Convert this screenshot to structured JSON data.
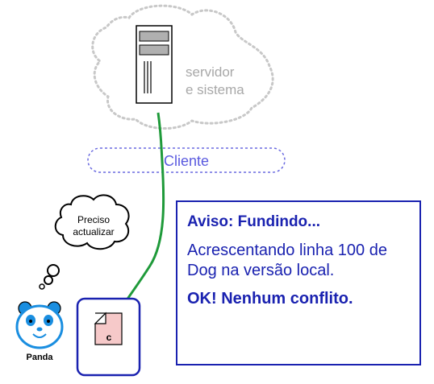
{
  "server": {
    "label_line1": "servidor",
    "label_line2": "e sistema"
  },
  "client": {
    "label": "Cliente"
  },
  "thought": {
    "line1": "Preciso",
    "line2": "actualizar"
  },
  "user": {
    "name": "Panda"
  },
  "file": {
    "letter": "c"
  },
  "notice": {
    "title": "Aviso: Fundindo...",
    "body": "Acrescentando linha 100 de Dog na versão local.",
    "result": "OK! Nenhum conflito."
  },
  "colors": {
    "accent": "#1a22b0",
    "arrow": "#1f9a3a",
    "cloud": "#c8c8c8",
    "client": "#5a5adf",
    "file": "#f6c9c9"
  }
}
